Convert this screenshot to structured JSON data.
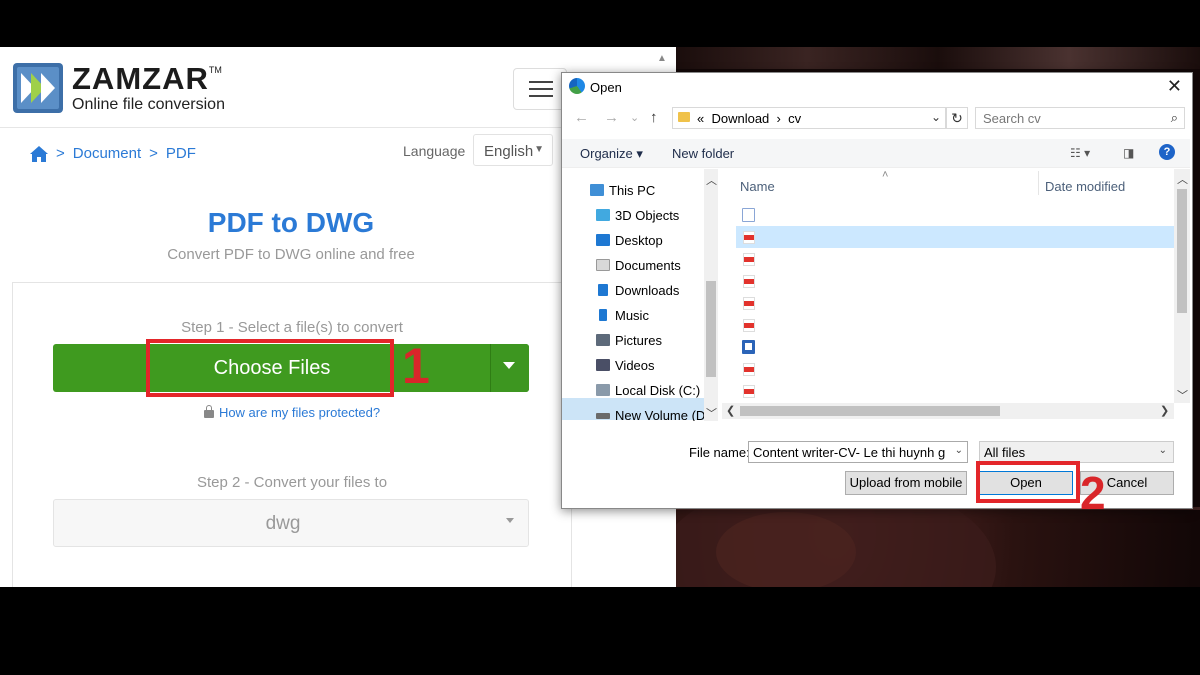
{
  "web": {
    "brand": "ZAMZAR",
    "trademark": "TM",
    "tagline": "Online file conversion",
    "breadcrumbs": [
      "Document",
      "PDF"
    ],
    "breadcrumb_sep": ">",
    "language_label": "Language",
    "language_value": "English",
    "title": "PDF to DWG",
    "subtitle": "Convert PDF to DWG online and free",
    "step1": "Step 1 - Select a file(s) to convert",
    "choose_files": "Choose Files",
    "protect_link": "How are my files protected?",
    "step2": "Step 2 - Convert your files to",
    "format_value": "dwg"
  },
  "annotations": {
    "one": "1",
    "two": "2",
    "color": "#e3262a"
  },
  "dialog": {
    "title": "Open",
    "close": "✕",
    "nav": {
      "back": "←",
      "forward": "→",
      "recent": "⌄",
      "up": "↑"
    },
    "address": {
      "prefix": "«",
      "parts": [
        "Download",
        "cv"
      ],
      "sep": "›"
    },
    "search_placeholder": "Search cv",
    "organize": "Organize",
    "new_folder": "New folder",
    "help": "?",
    "tree": [
      "This PC",
      "3D Objects",
      "Desktop",
      "Documents",
      "Downloads",
      "Music",
      "Pictures",
      "Videos",
      "Local Disk (C:)",
      "New Volume (D"
    ],
    "columns": {
      "name": "Name",
      "date": "Date modified"
    },
    "file_icons": [
      "doc",
      "pdf",
      "pdf",
      "pdf",
      "pdf",
      "pdf",
      "word",
      "pdf",
      "pdf"
    ],
    "selected_row": 1,
    "file_name_label": "File name:",
    "file_name_value": "Content writer-CV- Le thi huynh gam",
    "file_type": "All files",
    "btn_upload": "Upload from mobile",
    "btn_open": "Open",
    "btn_cancel": "Cancel"
  },
  "colors": {
    "brand_blue": "#2b7ad6",
    "green": "#3f9a1f",
    "accent_red": "#e3262a"
  }
}
